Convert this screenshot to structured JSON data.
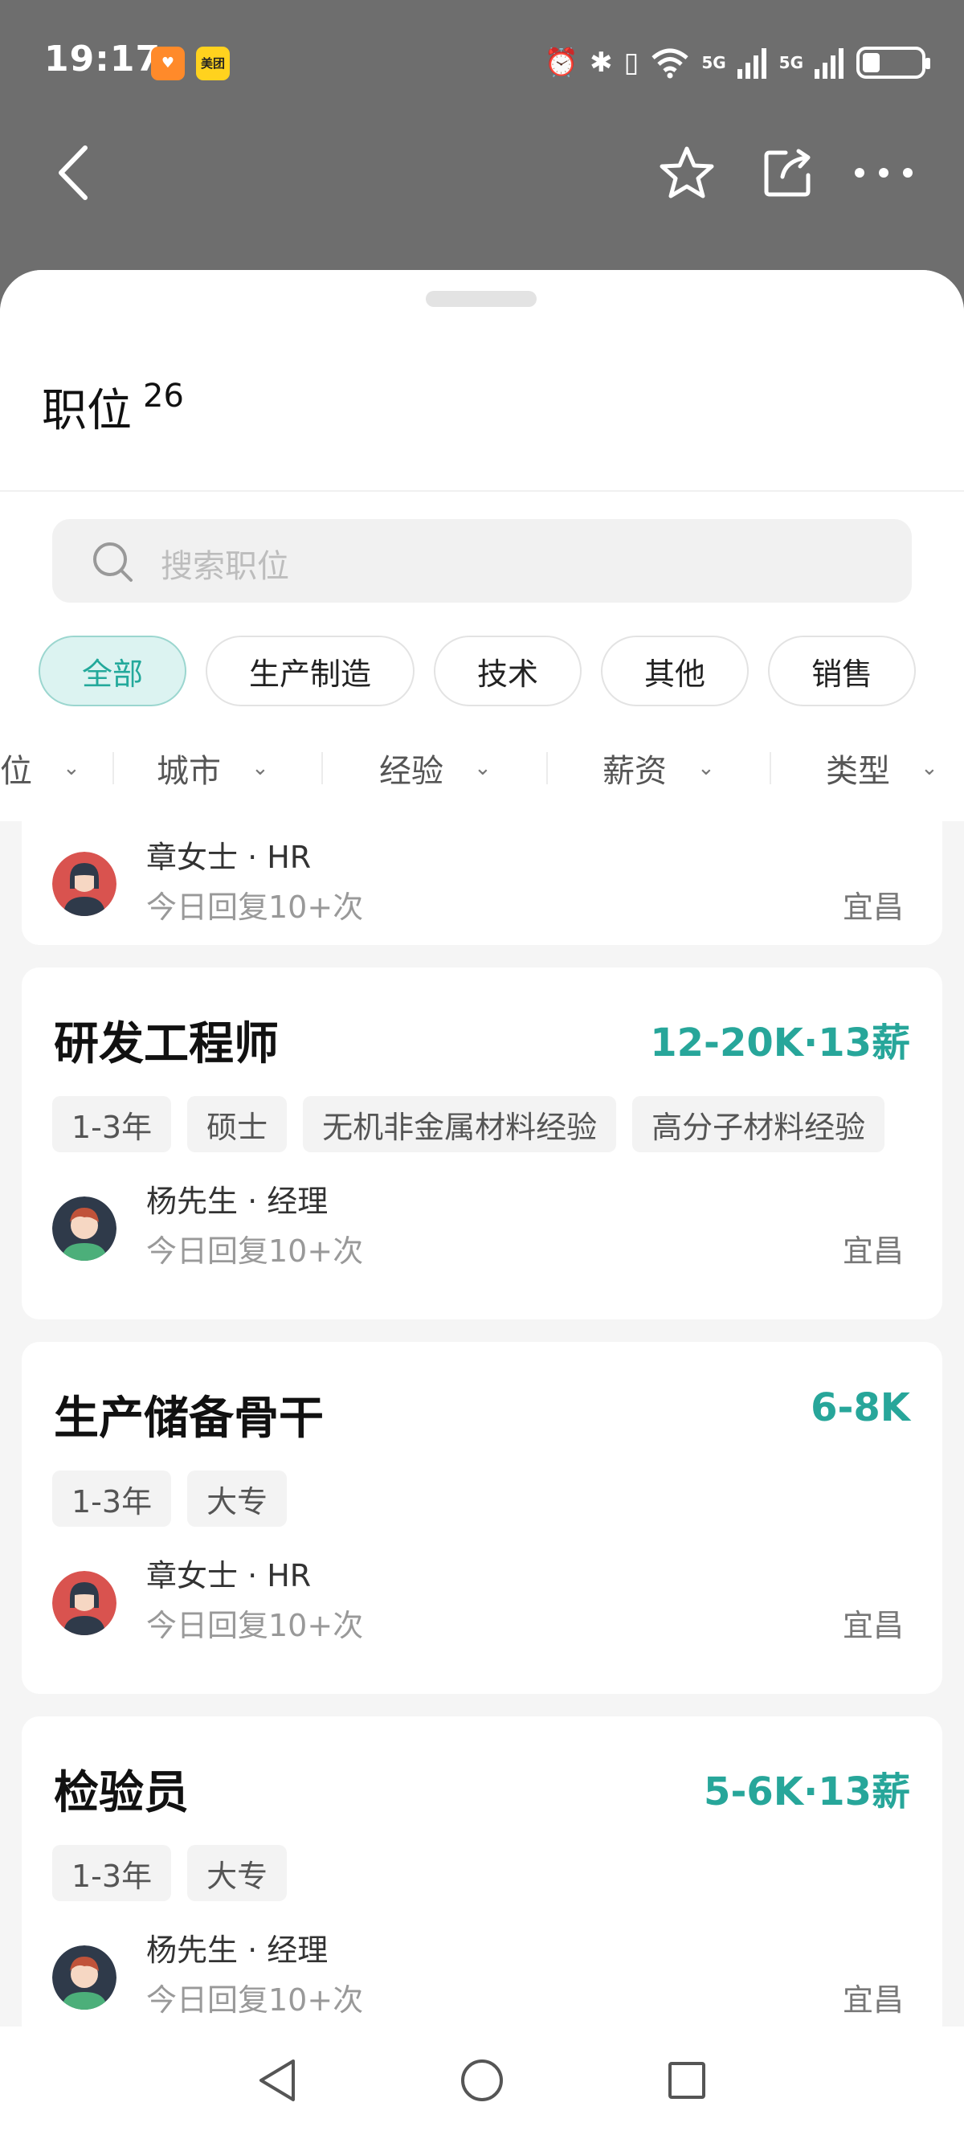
{
  "status_bar": {
    "time": "19:17",
    "badge_1": "♥",
    "badge_2": "美团",
    "network_1": "5G",
    "network_2": "5G",
    "battery_level": 0.3
  },
  "nav": {
    "back": "back-icon",
    "favorite": "star-icon",
    "share": "share-icon",
    "more": "more-icon"
  },
  "sheet": {
    "title": "职位",
    "count": "26",
    "search_placeholder": "搜索职位",
    "chips": [
      "全部",
      "生产制造",
      "技术",
      "其他",
      "销售"
    ],
    "active_chip": "全部",
    "filters": [
      "位",
      "城市",
      "经验",
      "薪资",
      "类型"
    ]
  },
  "jobs": [
    {
      "recruiter": "章女士 · HR",
      "reply": "今日回复10+次",
      "city": "宜昌"
    },
    {
      "title": "研发工程师",
      "salary": "12-20K·13薪",
      "tags": [
        "1-3年",
        "硕士",
        "无机非金属材料经验",
        "高分子材料经验"
      ],
      "recruiter": "杨先生 · 经理",
      "reply": "今日回复10+次",
      "city": "宜昌"
    },
    {
      "title": "生产储备骨干",
      "salary": "6-8K",
      "tags": [
        "1-3年",
        "大专"
      ],
      "recruiter": "章女士 · HR",
      "reply": "今日回复10+次",
      "city": "宜昌"
    },
    {
      "title": "检验员",
      "salary": "5-6K·13薪",
      "tags": [
        "1-3年",
        "大专"
      ],
      "recruiter": "杨先生 · 经理",
      "reply": "今日回复10+次",
      "city": "宜昌"
    }
  ],
  "colors": {
    "accent": "#27a69a",
    "chip_active_bg": "#dcf3f1",
    "top_bg": "#6e6e6e"
  }
}
